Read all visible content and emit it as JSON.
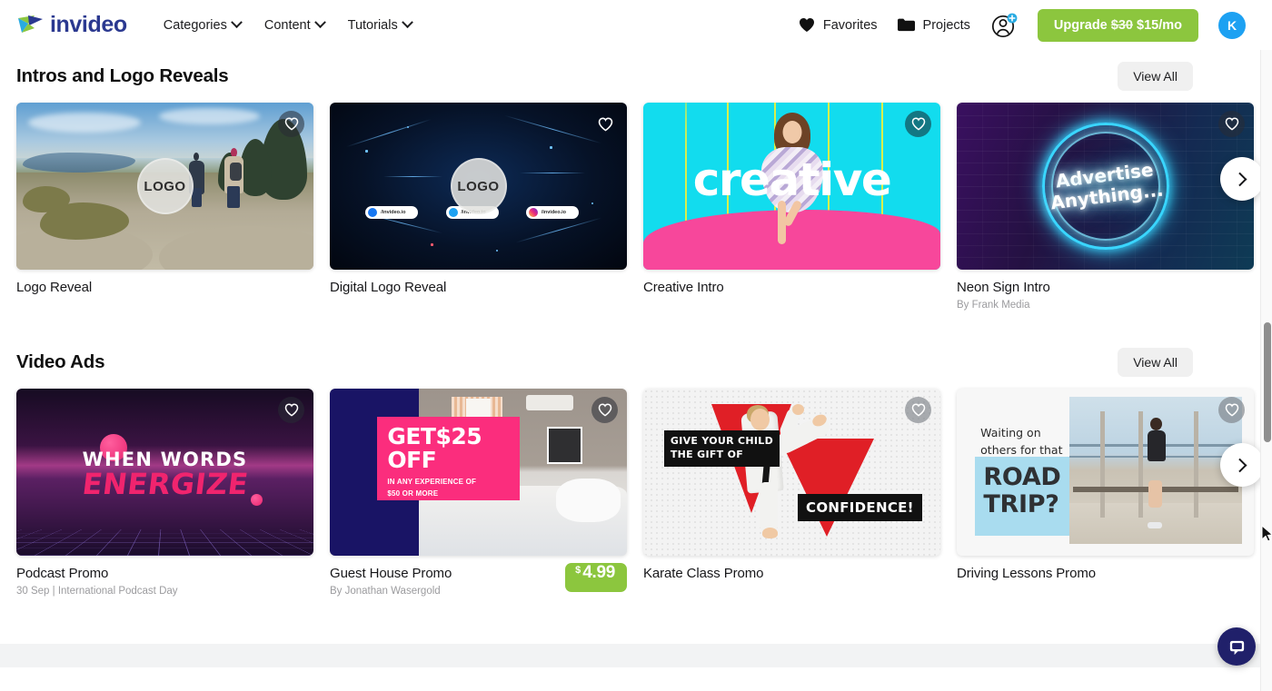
{
  "header": {
    "brand": "invideo",
    "brand_color": "#2b3990",
    "nav": [
      {
        "label": "Categories",
        "icon": "chevron-down-icon"
      },
      {
        "label": "Content",
        "icon": "chevron-down-icon"
      },
      {
        "label": "Tutorials",
        "icon": "chevron-down-icon"
      }
    ],
    "favorites_label": "Favorites",
    "projects_label": "Projects",
    "add_user_icon": "add-user-icon",
    "upgrade": {
      "prefix": "Upgrade",
      "old_price": "$30",
      "new_price": "$15/mo",
      "color": "#8cc63e"
    },
    "avatar_initial": "K",
    "avatar_color": "#1da1f2"
  },
  "sections": [
    {
      "title": "Intros and Logo Reveals",
      "view_all": "View All",
      "next_label": "chevron-right-icon",
      "cards": [
        {
          "title": "Logo Reveal",
          "subtitle": "",
          "price": "",
          "art": "hikers",
          "logo_text": "LOGO"
        },
        {
          "title": "Digital Logo Reveal",
          "subtitle": "",
          "price": "",
          "art": "digital",
          "logo_text": "LOGO",
          "social_handles": [
            "/invideo.io",
            "/invideo.io",
            "/invideo.io"
          ]
        },
        {
          "title": "Creative Intro",
          "subtitle": "",
          "price": "",
          "art": "creative",
          "word": "creative"
        },
        {
          "title": "Neon Sign Intro",
          "subtitle": "By Frank Media",
          "price": "",
          "art": "neon",
          "line1": "Advertise",
          "line2": "Anything..."
        }
      ]
    },
    {
      "title": "Video Ads",
      "view_all": "View All",
      "next_label": "chevron-right-icon",
      "cards": [
        {
          "title": "Podcast Promo",
          "subtitle": "30 Sep | International Podcast Day",
          "price": "",
          "art": "podcast",
          "line1": "WHEN WORDS",
          "line2": "ENERGIZE"
        },
        {
          "title": "Guest House Promo",
          "subtitle": "By Jonathan Wasergold",
          "price": "4.99",
          "currency": "$",
          "art": "guesthouse",
          "big1": "GET$25",
          "big2": "OFF",
          "small1": "IN ANY EXPERIENCE OF",
          "small2": "$50 OR MORE"
        },
        {
          "title": "Karate Class Promo",
          "subtitle": "",
          "price": "",
          "art": "karate",
          "bar1": "GIVE YOUR CHILD\nTHE GIFT OF",
          "bar2": "CONFIDENCE!"
        },
        {
          "title": "Driving Lessons Promo",
          "subtitle": "",
          "price": "",
          "art": "driving",
          "top": "Waiting on\nothers for that",
          "big": "ROAD\nTRIP?"
        }
      ]
    }
  ],
  "chat": {
    "icon": "chat-bubble-icon",
    "color": "#20206a"
  }
}
